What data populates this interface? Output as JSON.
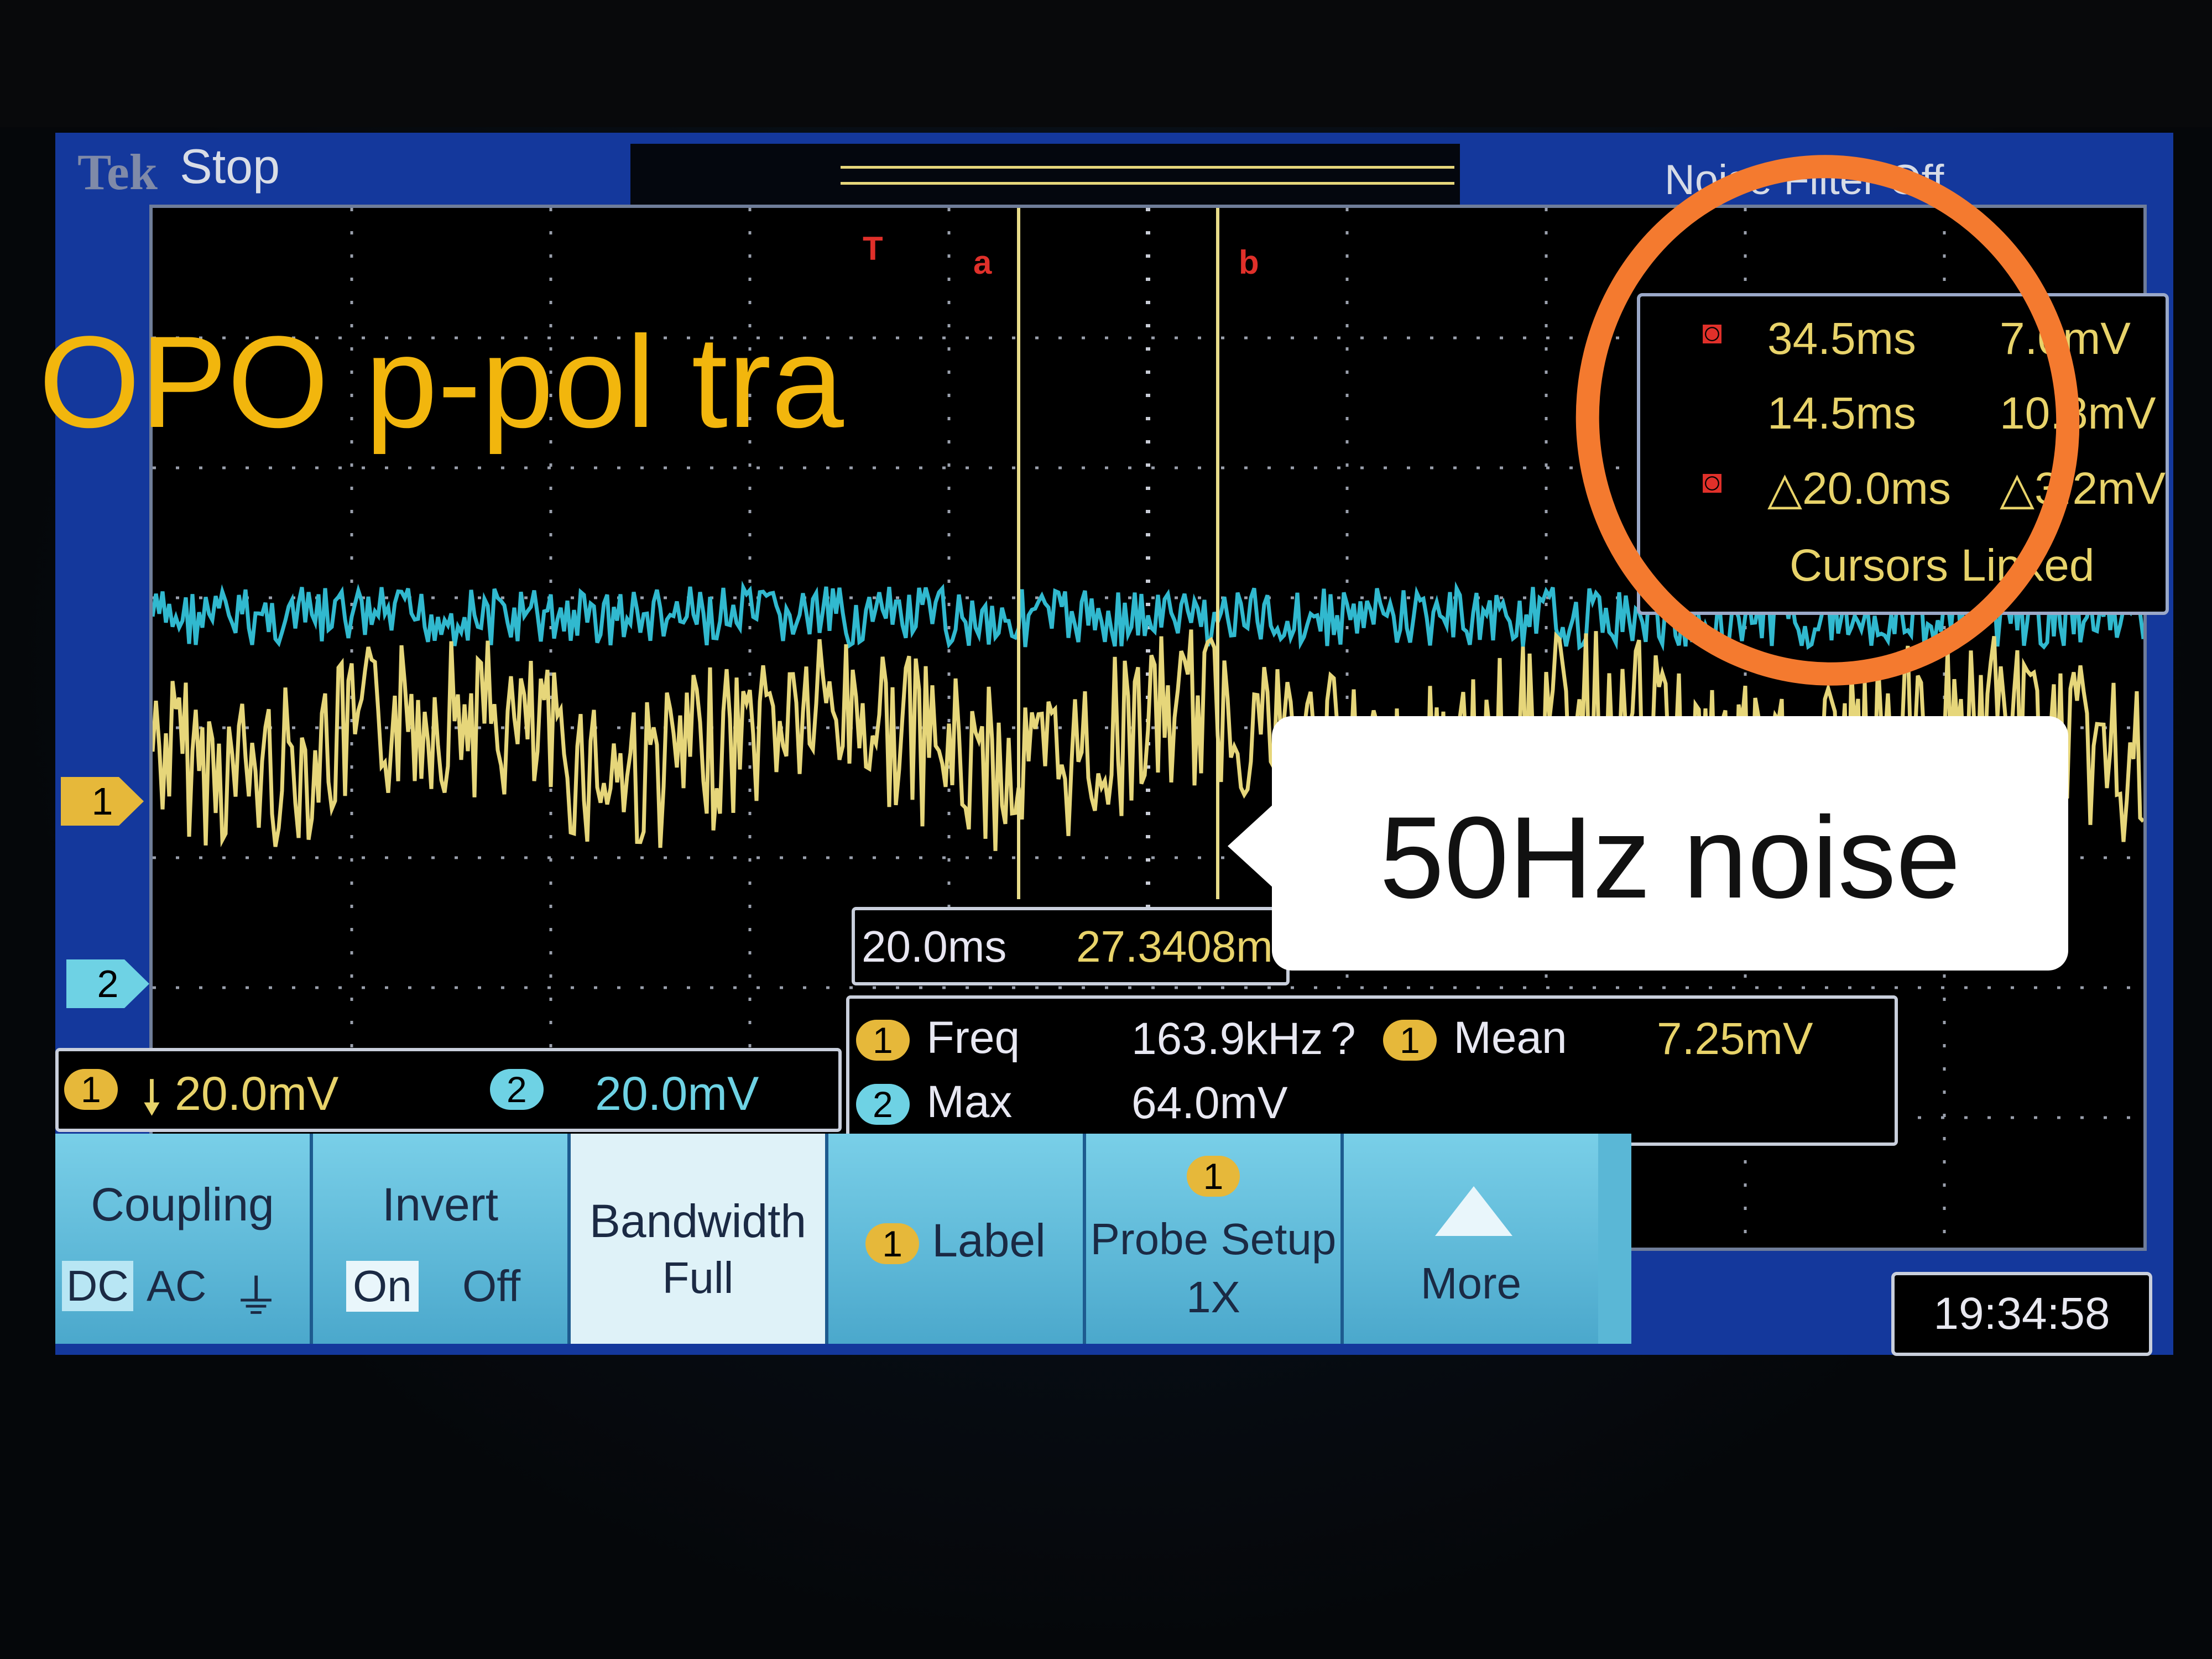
{
  "scope": {
    "brand": "Tek",
    "run_state": "Stop",
    "noise_filter": "Noise Filter Off",
    "channel1_marker": "1",
    "channel2_marker": "2",
    "cursor_markers": [
      "a",
      "b"
    ],
    "trigger_marker": "T",
    "colors": {
      "channel1": "#e6d67a",
      "channel2": "#31b9cf",
      "cursor": "#e0302a",
      "menu": "#5ab7d6",
      "screen": "#14389c"
    }
  },
  "cursor_readout": {
    "row_a": {
      "icon": "cursor-a-icon",
      "time": "34.5ms",
      "value": "7.0mV"
    },
    "row_b": {
      "time": "14.5ms",
      "value": "10.8mV"
    },
    "row_delta": {
      "icon": "cursor-b-icon",
      "time": "△20.0ms",
      "value": "△3.2mV"
    },
    "status": "Cursors Linked"
  },
  "cursor_time": {
    "delta": "20.0ms",
    "position": "27.3408ms"
  },
  "measurements": {
    "row1": {
      "ch1": "1",
      "label1": "Freq",
      "value1": "163.9kHz",
      "flag": "?",
      "ch2": "1",
      "label2": "Mean",
      "value2": "7.25mV"
    },
    "row2": {
      "ch": "2",
      "label": "Max",
      "value": "64.0mV"
    }
  },
  "vertical_scale": {
    "ch1_badge": "1",
    "ch1_value": "20.0mV",
    "ch1_symbol": "🠗",
    "ch2_badge": "2",
    "ch2_value": "20.0mV"
  },
  "menu": {
    "coupling": {
      "title": "Coupling",
      "dc": "DC",
      "ac": "AC",
      "gnd": "⏚"
    },
    "invert": {
      "title": "Invert",
      "on": "On",
      "off": "Off"
    },
    "bandwidth": {
      "title": "Bandwidth",
      "value": "Full"
    },
    "label": {
      "badge": "1",
      "title": "Label"
    },
    "probe_setup": {
      "badge": "1",
      "title": "Probe Setup",
      "value": "1X"
    },
    "more": {
      "title": "More"
    }
  },
  "clock": "19:34:58",
  "annotations": {
    "title": "OPO p-pol tra",
    "callout": "50Hz noise",
    "highlight_color": "#f47a2f",
    "title_color": "#f2b60d"
  }
}
